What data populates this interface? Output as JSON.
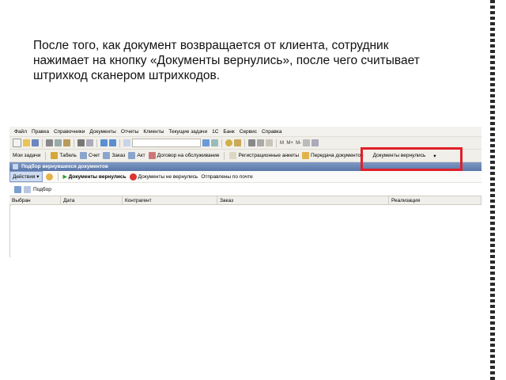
{
  "slide": {
    "lines": [
      "После того, как документ возвращается от клиента, сотрудник",
      "нажимает на кнопку «Документы вернулись», после чего считывает",
      "штрихкод сканером штрихкодов."
    ]
  },
  "menu": [
    "Файл",
    "Правка",
    "Справочники",
    "Документы",
    "Отчеты",
    "Клиенты",
    "Текущие задачи",
    "1С",
    "Банк",
    "Сервис",
    "Справка"
  ],
  "toolbar2": {
    "my_tasks": "Мои задачи",
    "tabel": "Табель",
    "schet": "Счет",
    "zakaz": "Заказ",
    "akt": "Акт",
    "dogovor": "Договор на обслуживание",
    "reg_ankety": "Регистрационные анкеты",
    "peredacha": "Передача документов",
    "docs_returned": "Документы вернулись"
  },
  "form": {
    "title": "Подбор вернувшихся документов",
    "actions": "Действия",
    "btn_returned": "Документы вернулись",
    "btn_not_returned": "Документы не вернулись",
    "sent_by_mail": "Отправлены по почте",
    "filter": "Подбор"
  },
  "table": {
    "columns": [
      "Выбран",
      "Дата",
      "Контрагент",
      "Заказ",
      "Реализация"
    ]
  },
  "colors": {
    "highlight": "#e0202a",
    "title_bar": "#5a77a8"
  }
}
